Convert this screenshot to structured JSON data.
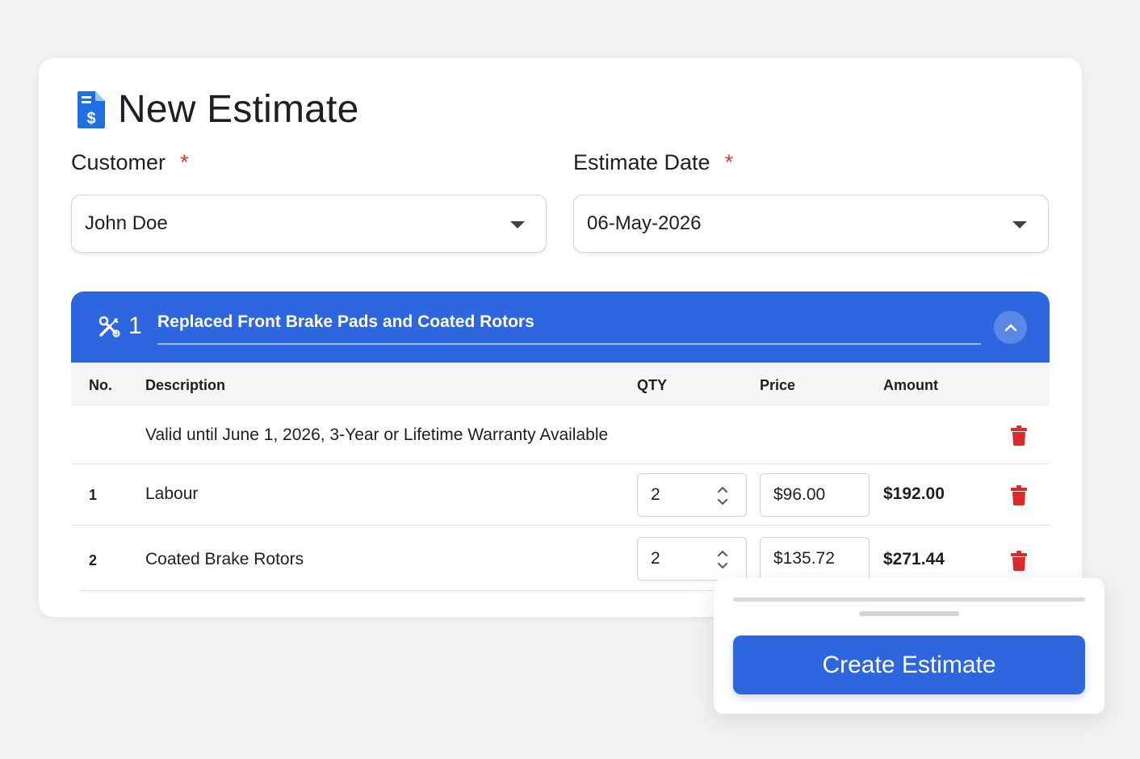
{
  "page": {
    "title": "New Estimate",
    "title_icon": "invoice-dollar-icon"
  },
  "form": {
    "customer": {
      "label": "Customer",
      "required_mark": "*",
      "value": "John Doe"
    },
    "estimate_date": {
      "label": "Estimate Date",
      "required_mark": "*",
      "value": "06-May-2026"
    }
  },
  "group": {
    "icon": "tools-icon",
    "number": "1",
    "title": "Replaced Front Brake Pads and Coated Rotors",
    "collapse_icon": "chevron-up-icon"
  },
  "table": {
    "columns": [
      "No.",
      "Description",
      "QTY",
      "Price",
      "Amount"
    ],
    "note_row": {
      "description": "Valid until June 1, 2026, 3-Year or Lifetime Warranty Available"
    },
    "rows": [
      {
        "no": "1",
        "description": "Labour",
        "qty": "2",
        "price": "$96.00",
        "amount": "$192.00"
      },
      {
        "no": "2",
        "description": "Coated Brake Rotors",
        "qty": "2",
        "price": "$135.72",
        "amount": "$271.44"
      }
    ]
  },
  "footer": {
    "create_label": "Create Estimate"
  },
  "colors": {
    "accent": "#2d66de",
    "danger": "#d92b2b",
    "required": "#e0382f",
    "background": "#f2f2f2"
  }
}
